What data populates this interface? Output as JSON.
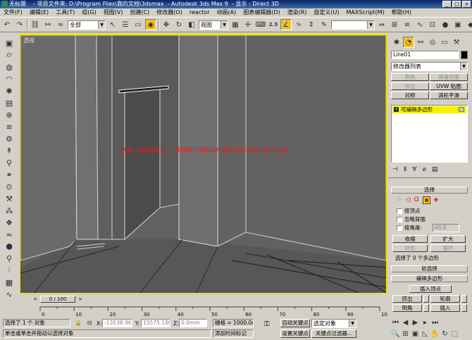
{
  "titlebar": {
    "app_title": "无标题",
    "project_prefix": "- 项目文件夹:",
    "project_path": "D:\\Program Files\\我的文档\\3dsmax",
    "app_name": "- Autodesk 3ds Max 9",
    "display_mode": "- 显示 : Direct 3D",
    "minimize": "_",
    "maximize": "□",
    "close": "×"
  },
  "menubar": [
    "文件(F)",
    "编辑(E)",
    "工具(T)",
    "组(G)",
    "视图(V)",
    "创建(C)",
    "修改器(O)",
    "reactor",
    "动画(A)",
    "图表编辑器(D)",
    "渲染(R)",
    "自定义(U)",
    "MAXScript(M)",
    "帮助(H)"
  ],
  "toolbar": {
    "selection_filter": "全部",
    "ref_coord": "视图",
    "snap_label": "2.5",
    "percent_label": "%",
    "named_selection": ""
  },
  "viewport": {
    "label": "透视",
    "note": "这样门洞就做好了，其他的门洞和窗户都用相同的方法制作出来",
    "colors": {
      "background": "#616161",
      "active_border": "#f0e000",
      "note": "#ff1414"
    }
  },
  "timeslider": {
    "position": "0 / 100",
    "prev": "<",
    "next": ">",
    "current_fraction": 0
  },
  "ruler": {
    "ticks": [
      "0",
      "10",
      "20",
      "30",
      "40",
      "50",
      "60",
      "70",
      "80",
      "90",
      "100"
    ]
  },
  "cmdpanel": {
    "object_name": "Line01",
    "object_color": "#000000",
    "modifier_list": "修改器列表",
    "mod_buttons": [
      {
        "label": "倒角",
        "enabled": false
      },
      {
        "label": "倒角剖面",
        "enabled": false
      },
      {
        "label": "挤出",
        "enabled": false
      },
      {
        "label": "UVW 贴图",
        "enabled": true
      },
      {
        "label": "对称",
        "enabled": true
      },
      {
        "label": "涡轮平滑",
        "enabled": true
      }
    ],
    "stack_item": "可编辑多边形",
    "select_rollout": {
      "header": "选择",
      "by_vertex": "按顶点",
      "ignore_backfacing": "忽略背面",
      "by_angle": "按角度:",
      "angle_value": "45.0",
      "shrink": "收缩",
      "grow": "扩大",
      "ring": "环形",
      "loop": "循环",
      "status": "选择了 0 个多边形"
    },
    "soft_selection": "软选择",
    "edit_polygons": "编辑多边形",
    "insert_vertex": "插入顶点",
    "extrude": "挤出",
    "outline": "轮廓",
    "bevel": "倒角",
    "inset": "插入"
  },
  "statusbar": {
    "selected": "选择了 1 个 对象",
    "prompt": "单击或单击并拖动以选择对象",
    "x_label": "X:",
    "x_value": "-13538.96",
    "y_label": "Y:",
    "y_value": "15575.186",
    "z_label": "Z:",
    "z_value": "0.0mm",
    "grid": "栅格 = 1000.0mm",
    "add_time_tag": "添加时间标记",
    "auto_key": "自动关键点",
    "set_key": "设置关键点",
    "selected_set": "选定对象",
    "key_filters": "关键点过滤器..."
  }
}
